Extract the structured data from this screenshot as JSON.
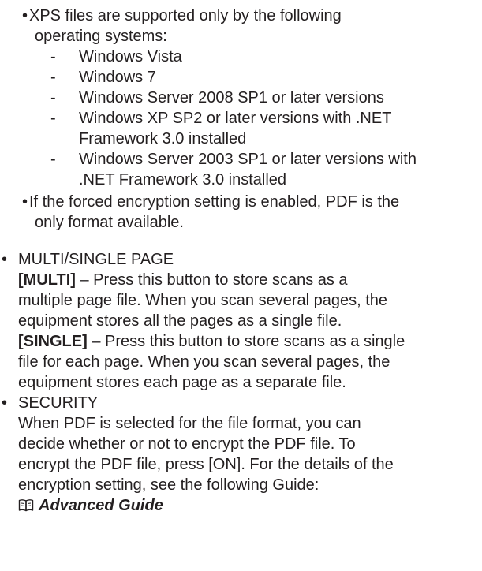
{
  "notes": {
    "xps": {
      "line1": "XPS files are supported only by the following",
      "line2": "operating systems:",
      "os_list": [
        [
          "Windows Vista"
        ],
        [
          "Windows 7"
        ],
        [
          "Windows Server 2008 SP1 or later versions"
        ],
        [
          "Windows XP SP2 or later versions with .NET",
          "Framework 3.0 installed"
        ],
        [
          "Windows Server 2003 SP1 or later versions with",
          ".NET Framework 3.0 installed"
        ]
      ]
    },
    "encryption": {
      "line1": "If the forced encryption setting is enabled, PDF is the",
      "line2": "only format available."
    }
  },
  "multi_single": {
    "heading": "MULTI/SINGLE PAGE",
    "multi_label": "[MULTI]",
    "multi_line1_rest": " – Press this button to store scans as a",
    "multi_line2": "multiple page file. When you scan several pages, the",
    "multi_line3": "equipment stores all the pages as a single file.",
    "single_label": "[SINGLE]",
    "single_line1_rest": " – Press this button to store scans as a single",
    "single_line2": "file for each page. When you scan several pages, the",
    "single_line3": "equipment stores each page as a separate file."
  },
  "security": {
    "heading": "SECURITY",
    "line1": "When PDF is selected for the file format, you can",
    "line2": "decide whether or not to encrypt the PDF file. To",
    "line3": "encrypt the PDF file, press [ON]. For the details of the",
    "line4": "encryption setting, see the following Guide:",
    "guide_link": "Advanced Guide"
  }
}
